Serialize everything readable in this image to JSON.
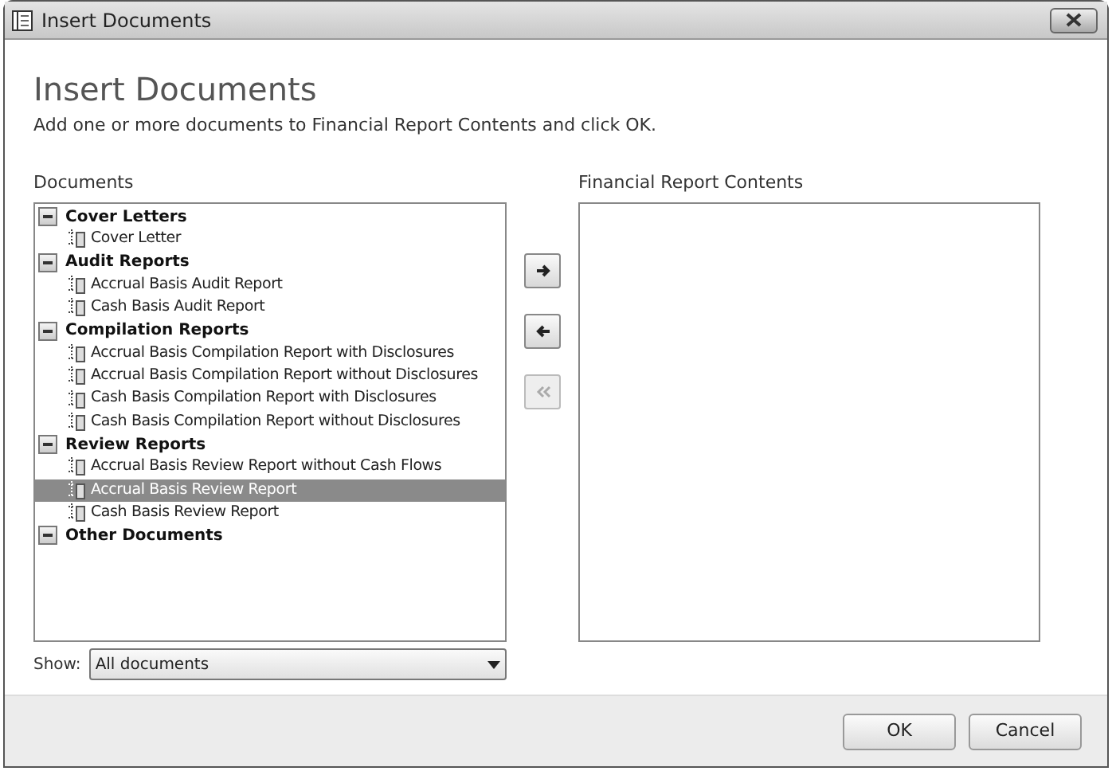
{
  "window": {
    "title": "Insert Documents"
  },
  "heading": "Insert Documents",
  "instructions": "Add one or more documents to Financial Report Contents and click OK.",
  "documents": {
    "label": "Documents",
    "groups": [
      {
        "label": "Cover Letters",
        "expanded": true,
        "children": [
          {
            "label": "Cover Letter",
            "selected": false
          }
        ]
      },
      {
        "label": "Audit Reports",
        "expanded": true,
        "children": [
          {
            "label": "Accrual Basis Audit Report",
            "selected": false
          },
          {
            "label": "Cash Basis Audit Report",
            "selected": false
          }
        ]
      },
      {
        "label": "Compilation Reports",
        "expanded": true,
        "children": [
          {
            "label": "Accrual Basis Compilation Report with Disclosures",
            "selected": false
          },
          {
            "label": "Accrual Basis Compilation Report without Disclosures",
            "selected": false
          },
          {
            "label": "Cash Basis Compilation Report with Disclosures",
            "selected": false
          },
          {
            "label": "Cash Basis Compilation Report without Disclosures",
            "selected": false
          }
        ]
      },
      {
        "label": "Review Reports",
        "expanded": true,
        "children": [
          {
            "label": "Accrual Basis Review Report without Cash Flows",
            "selected": false
          },
          {
            "label": "Accrual Basis Review Report",
            "selected": true
          },
          {
            "label": "Cash Basis Review Report",
            "selected": false
          }
        ]
      },
      {
        "label": "Other Documents",
        "expanded": true
      }
    ]
  },
  "move_buttons": [
    {
      "kind": "add",
      "disabled": false
    },
    {
      "kind": "remove",
      "disabled": false
    },
    {
      "kind": "remove_all",
      "disabled": true
    }
  ],
  "contents": {
    "label": "Financial Report Contents"
  },
  "show": {
    "label": "Show:",
    "value": "All documents"
  },
  "buttons": [
    "OK",
    "Cancel"
  ]
}
